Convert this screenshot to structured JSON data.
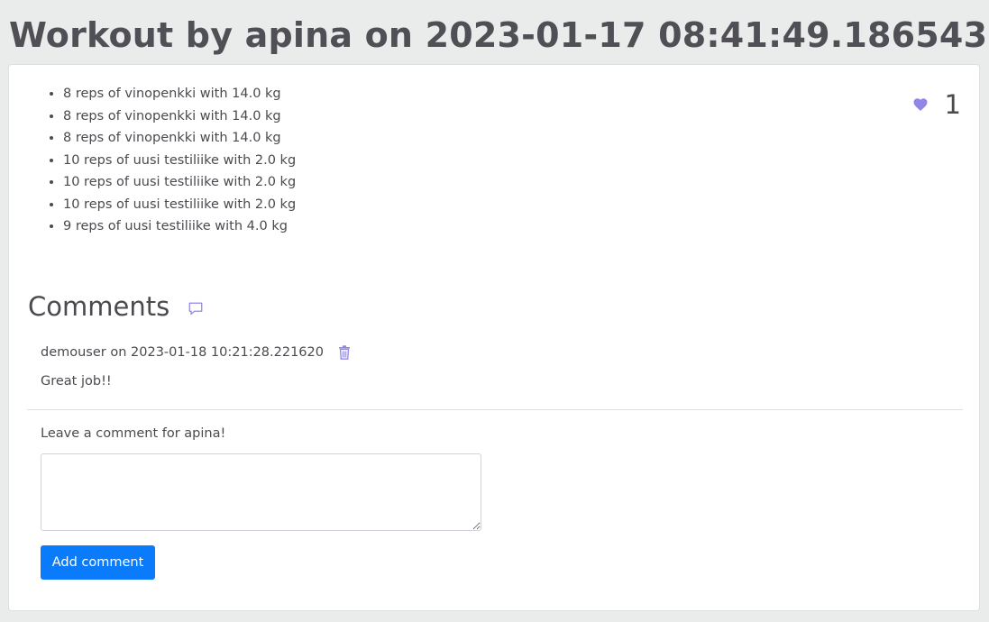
{
  "page": {
    "title": "Workout by apina on 2023-01-17 08:41:49.186543"
  },
  "workout": {
    "sets": [
      "8 reps of vinopenkki with 14.0 kg",
      "8 reps of vinopenkki with 14.0 kg",
      "8 reps of vinopenkki with 14.0 kg",
      "10 reps of uusi testiliike with 2.0 kg",
      "10 reps of uusi testiliike with 2.0 kg",
      "10 reps of uusi testiliike with 2.0 kg",
      "9 reps of uusi testiliike with 4.0 kg"
    ],
    "likes": "1",
    "heart_icon": "heart-icon"
  },
  "comments": {
    "heading": "Comments",
    "heading_icon": "comment-icon",
    "items": [
      {
        "meta": "demouser on 2023-01-18 10:21:28.221620",
        "text": "Great job!!",
        "delete_icon": "trash-icon"
      }
    ]
  },
  "form": {
    "label": "Leave a comment for apina!",
    "value": "",
    "placeholder": "",
    "button_label": "Add comment"
  },
  "colors": {
    "accent_icon": "#8f86e6",
    "button": "#0a7cfb",
    "background": "#e9eceb"
  }
}
